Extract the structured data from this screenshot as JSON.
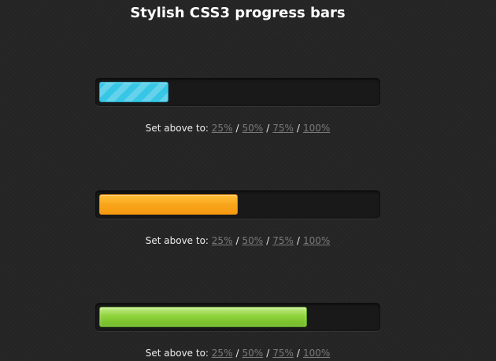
{
  "page": {
    "title": "Stylish CSS3 progress bars"
  },
  "colors": {
    "background": "#252525",
    "track": "#191919",
    "blue": "#38c6e6",
    "orange": "#f9a51c",
    "green": "#8fd33b",
    "link": "#7a7a7a"
  },
  "bars": [
    {
      "style": "blue-striped",
      "progress_fraction": 0.25,
      "controls": {
        "label": "Set above to:",
        "options": [
          "25%",
          "50%",
          "75%",
          "100%"
        ],
        "separator": "/"
      }
    },
    {
      "style": "orange",
      "progress_fraction": 0.5,
      "controls": {
        "label": "Set above to:",
        "options": [
          "25%",
          "50%",
          "75%",
          "100%"
        ],
        "separator": "/"
      }
    },
    {
      "style": "green",
      "progress_fraction": 0.75,
      "controls": {
        "label": "Set above to:",
        "options": [
          "25%",
          "50%",
          "75%",
          "100%"
        ],
        "separator": "/"
      }
    }
  ]
}
